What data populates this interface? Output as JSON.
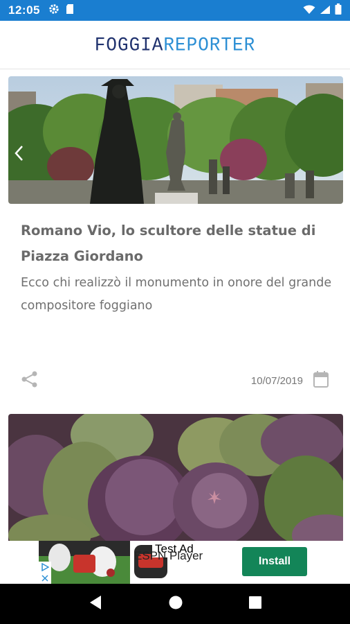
{
  "status_bar": {
    "time": "12:05",
    "left_icons": [
      "settings-icon",
      "sd-card-icon"
    ],
    "right_icons": [
      "wifi-icon",
      "signal-icon",
      "battery-icon"
    ],
    "color": "#1a7ed0"
  },
  "header": {
    "logo_part1": "FOGGIA",
    "logo_part2": "REPORTER"
  },
  "articles": [
    {
      "title": "Romano Vio, lo scultore delle statue di Piazza Giordano",
      "subtitle": "Ecco chi realizzò il monumento in onore del grande compositore foggiano",
      "date": "10/07/2019",
      "image": "statues-in-park-photo"
    },
    {
      "image": "figs-photo"
    }
  ],
  "ad": {
    "label": "Test Ad",
    "app_name": "ESPN Player",
    "install_label": "Install",
    "install_color": "#138558"
  },
  "nav": {
    "buttons": [
      "back-icon",
      "home-icon",
      "recents-icon"
    ]
  }
}
